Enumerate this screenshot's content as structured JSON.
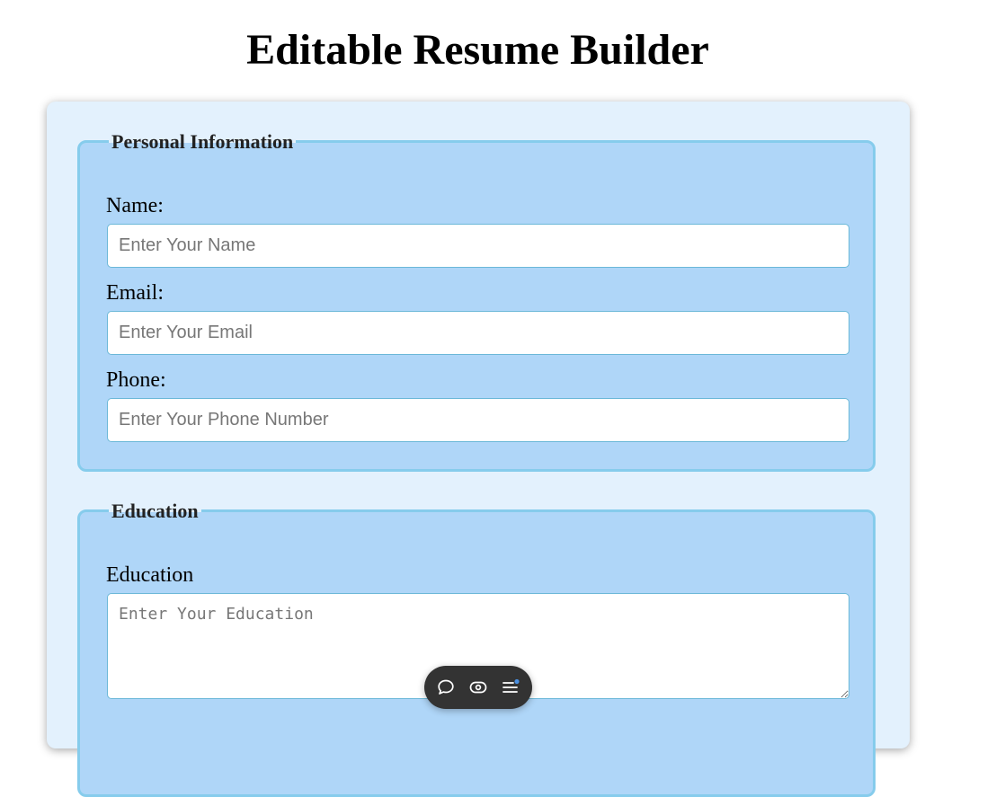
{
  "page": {
    "title": "Editable Resume Builder"
  },
  "personal": {
    "legend": "Personal Information",
    "name_label": "Name:",
    "name_placeholder": "Enter Your Name",
    "email_label": "Email:",
    "email_placeholder": "Enter Your Email",
    "phone_label": "Phone:",
    "phone_placeholder": "Enter Your Phone Number"
  },
  "education": {
    "legend": "Education",
    "label": "Education",
    "placeholder": "Enter Your Education"
  },
  "toolbar": {
    "icons": [
      "comment-icon",
      "eye-icon",
      "menu-icon"
    ]
  },
  "colors": {
    "container_bg": "#e3f1fd",
    "section_bg": "#afd6f8",
    "section_border": "#86ccec",
    "toolbar_bg": "#333333",
    "notification_dot": "#4a90e2"
  }
}
